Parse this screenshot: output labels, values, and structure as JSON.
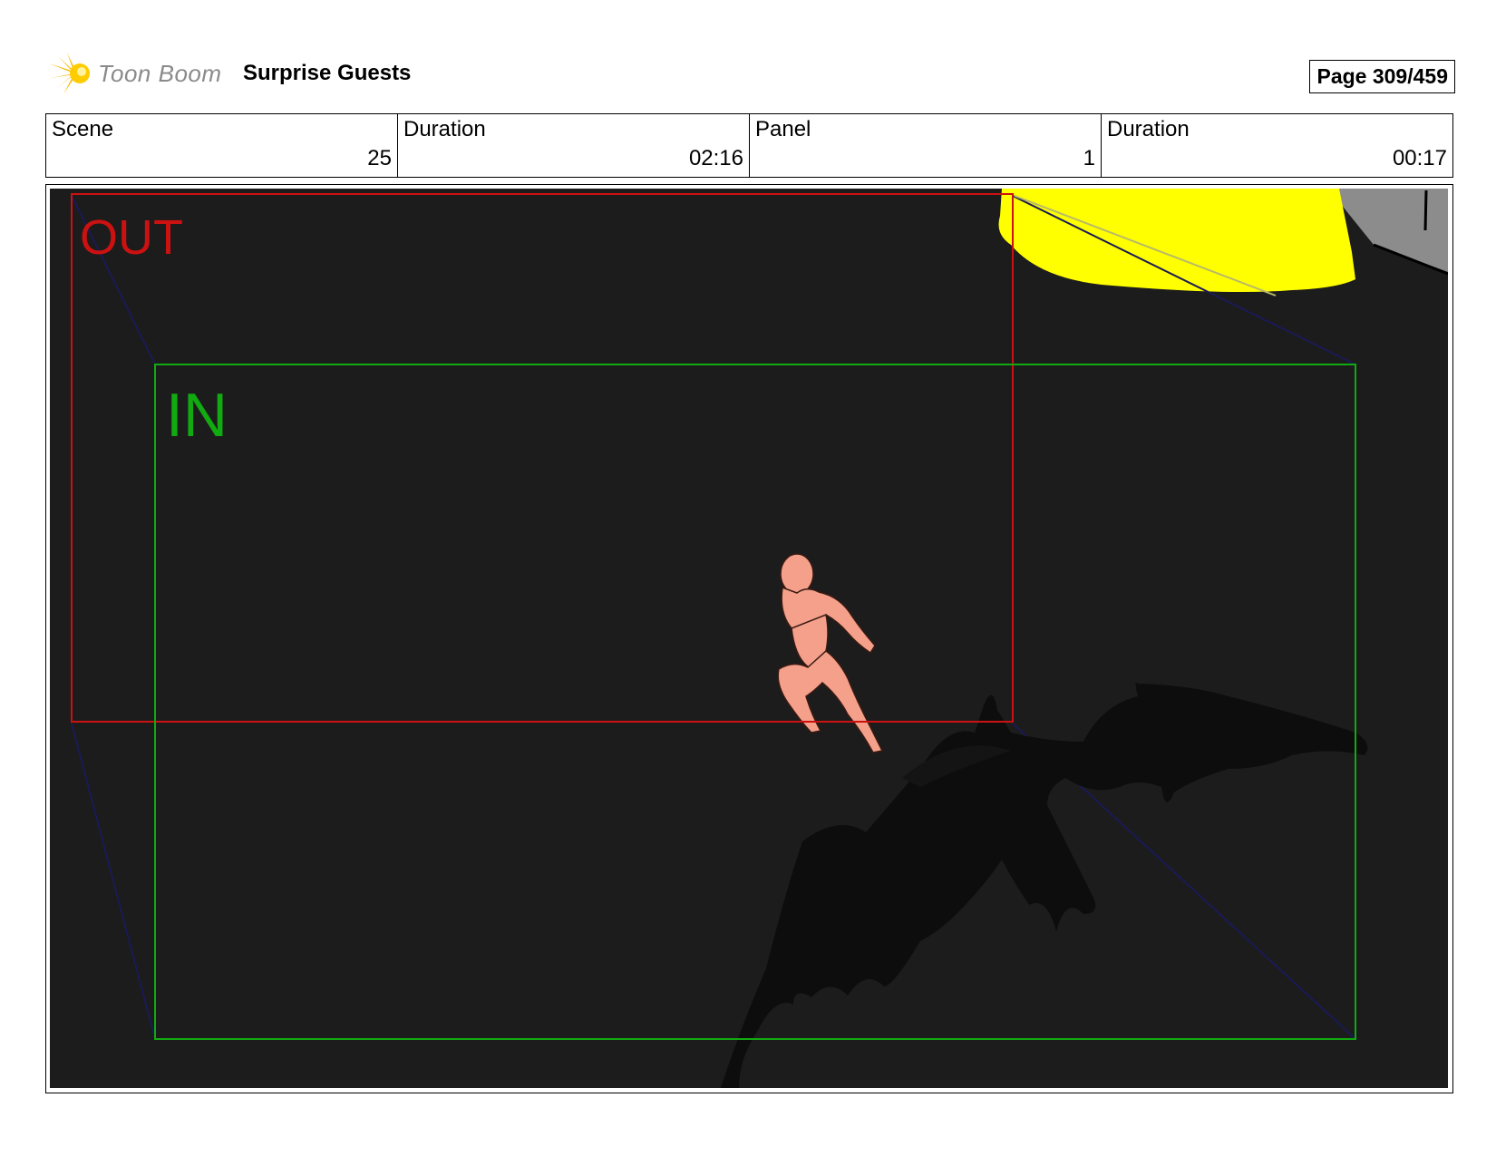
{
  "header": {
    "logo_text": "Toon Boom",
    "project_title": "Surprise Guests",
    "page_label": "Page 309/459"
  },
  "info": {
    "scene_label": "Scene",
    "scene_value": "25",
    "scene_duration_label": "Duration",
    "scene_duration_value": "02:16",
    "panel_label": "Panel",
    "panel_value": "1",
    "panel_duration_label": "Duration",
    "panel_duration_value": "00:17"
  },
  "panel": {
    "out_label": "OUT",
    "in_label": "IN",
    "colors": {
      "background": "#1c1c1c",
      "out_frame": "#cc1111",
      "in_frame": "#11aa11",
      "light": "#ffff00",
      "figure": "#f4a08a",
      "shadow": "#0d0d0d"
    }
  }
}
